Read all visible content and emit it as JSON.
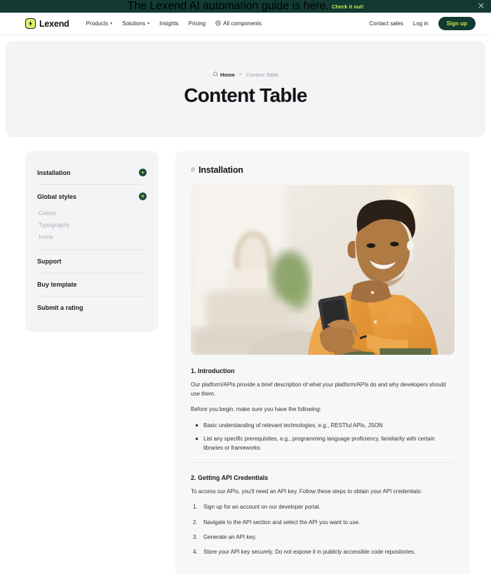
{
  "banner": {
    "text": "The Lexend AI automation guide is here.",
    "link_label": "Check it out!",
    "close_icon": "close-icon",
    "background": "#123a33",
    "link_color": "#c3e84b"
  },
  "navbar": {
    "brand": "Lexend",
    "links": [
      {
        "label": "Products",
        "has_caret": true
      },
      {
        "label": "Solutions",
        "has_caret": true
      },
      {
        "label": "Insights",
        "has_caret": false
      },
      {
        "label": "Pricing",
        "has_caret": false
      },
      {
        "label": "All components",
        "has_caret": false,
        "icon": "components-icon"
      }
    ],
    "contact_label": "Contact sales",
    "login_label": "Log in",
    "signup_label": "Sign up",
    "signup_bg": "#123a33",
    "signup_color": "#c3e84b"
  },
  "hero": {
    "breadcrumb_home": "Home",
    "breadcrumb_separator": ">",
    "breadcrumb_current": "Content Table",
    "title": "Content Table",
    "background": "#f3f4f5"
  },
  "sidebar": {
    "items": [
      {
        "label": "Installation",
        "toggle": "+",
        "expanded": false
      },
      {
        "label": "Global styles",
        "toggle": "×",
        "expanded": true
      }
    ],
    "subitems": [
      "Colors",
      "Typography",
      "Icons"
    ],
    "links": [
      "Support",
      "Buy template",
      "Submit a rating"
    ]
  },
  "main": {
    "hash": "#",
    "title": "Installation",
    "image_alt": "Smiling man in orange shirt with wireless earbud using a smartphone in a bright living room",
    "sections": [
      {
        "title": "1. Introduction",
        "paragraphs": [
          "Our platform/APIs provide a brief description of what your platform/APIs do and why developers should use them.",
          "Before you begin, make sure you have the following:"
        ],
        "bullets": [
          "Basic understanding of relevant technologies, e.g., RESTful APIs, JSON",
          "List any specific prerequisites, e.g., programming language proficiency, familiarity with certain libraries or frameworks"
        ]
      },
      {
        "title": "2. Getting API Credentials",
        "paragraphs": [
          "To access our APIs, you'll need an API key. Follow these steps to obtain your API credentials:"
        ],
        "steps": [
          "Sign up for an account on our developer portal.",
          "Navigate to the API section and select the API you want to use.",
          "Generate an API key.",
          "Store your API key securely. Do not expose it in publicly accessible code repositories."
        ]
      }
    ]
  }
}
